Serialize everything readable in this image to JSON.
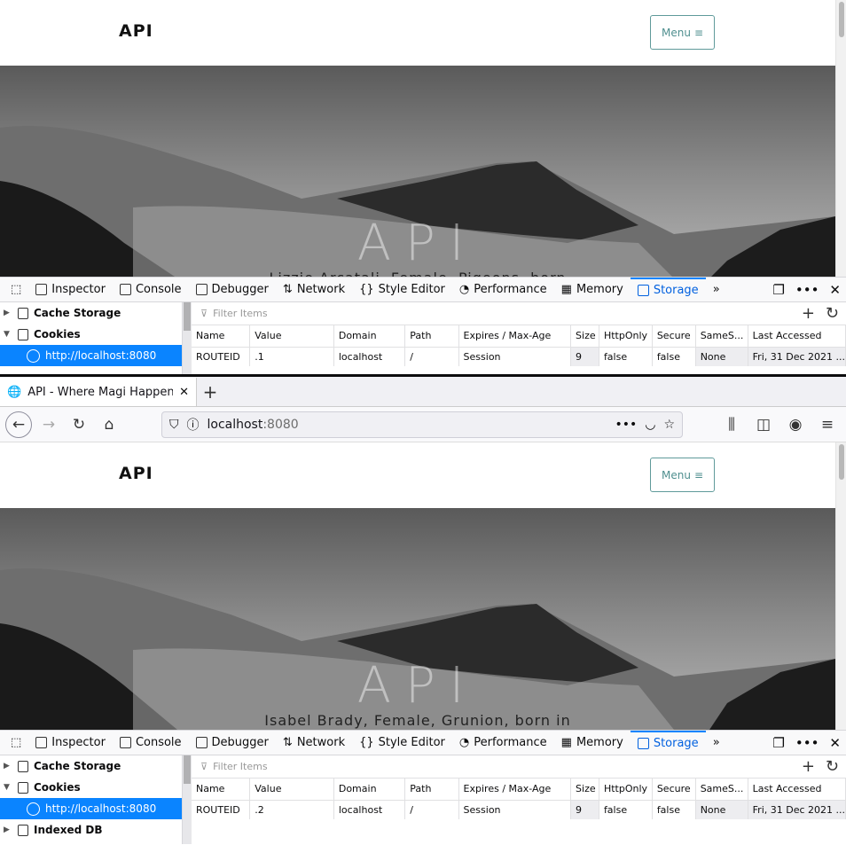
{
  "top": {
    "page": {
      "logo": "API",
      "menu_label": "Menu",
      "hero_title": "API",
      "hero_subtitle": "Lizzie Arcatali, Female, Pigeons, born"
    },
    "devtools": {
      "tools": [
        "Inspector",
        "Console",
        "Debugger",
        "Network",
        "Style Editor",
        "Performance",
        "Memory",
        "Storage"
      ],
      "selected_tool": "Storage",
      "sidebar": [
        {
          "label": "Cache Storage",
          "expanded": false
        },
        {
          "label": "Cookies",
          "expanded": true
        }
      ],
      "selected_host": "http://localhost:8080",
      "filter_placeholder": "Filter Items",
      "columns": [
        "Name",
        "Value",
        "Domain",
        "Path",
        "Expires / Max-Age",
        "Size",
        "HttpOnly",
        "Secure",
        "SameS...",
        "Last Accessed"
      ],
      "rows": [
        [
          "ROUTEID",
          ".1",
          "localhost",
          "/",
          "Session",
          "9",
          "false",
          "false",
          "None",
          "Fri, 31 Dec 2021 ..."
        ]
      ]
    }
  },
  "bottom": {
    "browser": {
      "tab_title": "API - Where Magi Happen",
      "url_host": "localhost",
      "url_port": ":8080"
    },
    "page": {
      "logo": "API",
      "menu_label": "Menu",
      "hero_title": "API",
      "hero_subtitle": "Isabel Brady, Female, Grunion, born in"
    },
    "devtools": {
      "tools": [
        "Inspector",
        "Console",
        "Debugger",
        "Network",
        "Style Editor",
        "Performance",
        "Memory",
        "Storage"
      ],
      "selected_tool": "Storage",
      "sidebar": [
        {
          "label": "Cache Storage",
          "expanded": false
        },
        {
          "label": "Cookies",
          "expanded": true
        },
        {
          "label": "Indexed DB",
          "expanded": false
        }
      ],
      "selected_host": "http://localhost:8080",
      "filter_placeholder": "Filter Items",
      "columns": [
        "Name",
        "Value",
        "Domain",
        "Path",
        "Expires / Max-Age",
        "Size",
        "HttpOnly",
        "Secure",
        "SameS...",
        "Last Accessed"
      ],
      "rows": [
        [
          "ROUTEID",
          ".2",
          "localhost",
          "/",
          "Session",
          "9",
          "false",
          "false",
          "None",
          "Fri, 31 Dec 2021 ..."
        ]
      ]
    }
  },
  "colors": {
    "accent": "#0a84ff",
    "menu_border": "#5f9a9a"
  }
}
